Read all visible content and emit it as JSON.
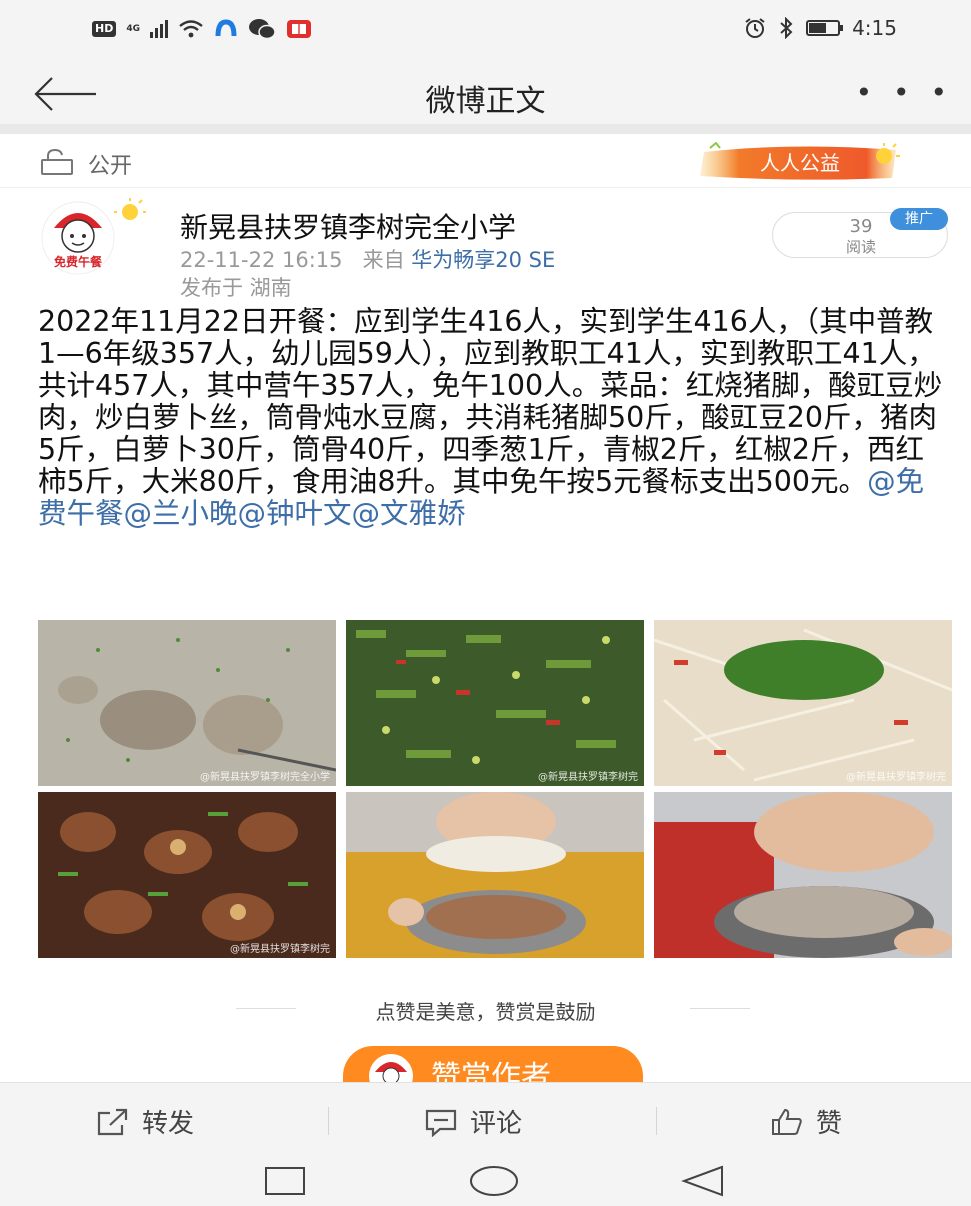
{
  "status_bar": {
    "network": "4G",
    "time": "4:15",
    "battery_level": 0.6
  },
  "header": {
    "title": "微博正文",
    "more": "• • •"
  },
  "visibility": {
    "label": "公开",
    "banner_text": "人人公益"
  },
  "author": {
    "avatar_label": "免费午餐",
    "name": "新晃县扶罗镇李树完全小学",
    "datetime": "22-11-22 16:15",
    "source_prefix": "来自",
    "device": "华为畅享20 SE",
    "location": "发布于 湖南",
    "read_count": "39",
    "read_label": "阅读",
    "promo_tag": "推广"
  },
  "post": {
    "text": "2022年11月22日开餐：应到学生416人，实到学生416人，（其中普教1—6年级357人，幼儿园59人），应到教职工41人，实到教职工41人，共计457人，其中营午357人，免午100人。菜品：红烧猪脚，酸豇豆炒肉，炒白萝卜丝，筒骨炖水豆腐，共消耗猪脚50斤，酸豇豆20斤，猪肉5斤，白萝卜30斤，筒骨40斤，四季葱1斤，青椒2斤，红椒2斤，西红柿5斤，大米80斤，食用油8升。其中免午按5元餐标支出500元。",
    "mentions": "@免费午餐@兰小晚@钟叶文@文雅娇"
  },
  "photos": [
    {
      "name": "photo-bone-soup",
      "watermark": "@新晃县扶罗镇李树完全小学"
    },
    {
      "name": "photo-cowpea-pork",
      "watermark": "@新晃县扶罗镇李树完"
    },
    {
      "name": "photo-radish-shreds",
      "watermark": "@新晃县扶罗镇李树完"
    },
    {
      "name": "photo-braised-trotters",
      "watermark": "@新晃县扶罗镇李树完"
    },
    {
      "name": "photo-child-eating-1",
      "watermark": ""
    },
    {
      "name": "photo-child-eating-2",
      "watermark": ""
    }
  ],
  "reward": {
    "caption": "点赞是美意，赞赏是鼓励",
    "button_label": "赞赏作者"
  },
  "actions": {
    "repost": "转发",
    "comment": "评论",
    "like": "赞"
  },
  "colors": {
    "link": "#3e6ea8",
    "reward": "#ff8a1f",
    "promo": "#3e8fdc"
  }
}
